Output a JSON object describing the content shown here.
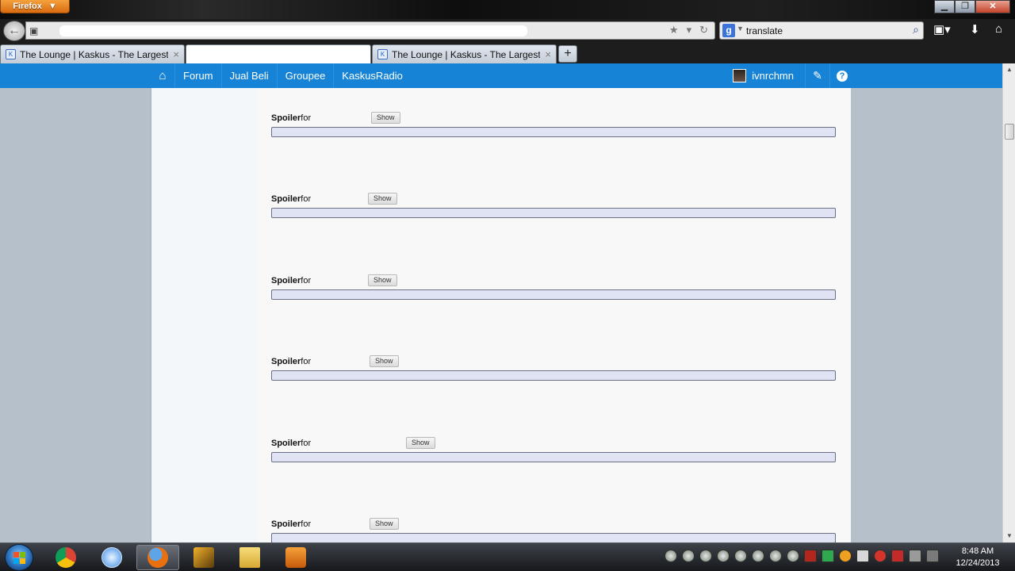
{
  "browser": {
    "app_menu_label": "Firefox",
    "search_value": "translate",
    "tabs": [
      {
        "title": "The Lounge | Kaskus - The Largest In...",
        "close": "×"
      },
      {
        "title": "",
        "close": ""
      },
      {
        "title": "The Lounge | Kaskus - The Largest In...",
        "close": "×"
      }
    ],
    "new_tab_label": "+"
  },
  "site": {
    "nav_items": [
      "Forum",
      "Jual Beli",
      "Groupee",
      "KaskusRadio"
    ],
    "username": "ivnrchmn",
    "accent_color": "#1683d6"
  },
  "spoilers": [
    {
      "label_bold": "Spoiler",
      "label_rest": "for",
      "button": "Show"
    },
    {
      "label_bold": "Spoiler",
      "label_rest": "for",
      "button": "Show"
    },
    {
      "label_bold": "Spoiler",
      "label_rest": "for",
      "button": "Show"
    },
    {
      "label_bold": "Spoiler",
      "label_rest": "for",
      "button": "Show"
    },
    {
      "label_bold": "Spoiler",
      "label_rest": "for",
      "button": "Show"
    },
    {
      "label_bold": "Spoiler",
      "label_rest": "for",
      "button": "Show"
    }
  ],
  "taskbar": {
    "apps": [
      "chrome-icon",
      "itunes-icon",
      "firefox-icon",
      "winamp-icon",
      "file-explorer-icon",
      "media-player-icon"
    ],
    "active_app": "firefox-icon",
    "time": "8:48 AM",
    "date": "12/24/2013"
  }
}
